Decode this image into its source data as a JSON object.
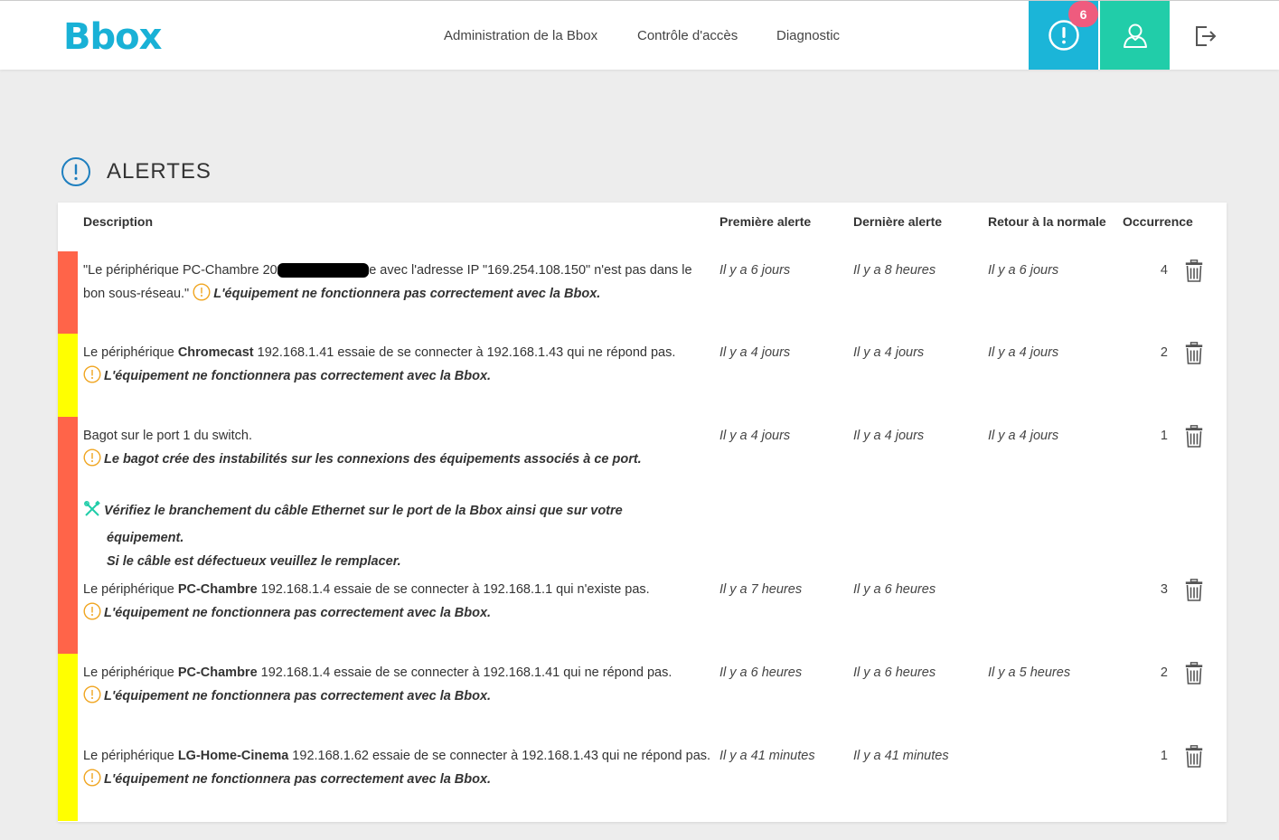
{
  "header": {
    "logo": "Bbox",
    "nav": [
      "Administration de la Bbox",
      "Contrôle d'accès",
      "Diagnostic"
    ],
    "alert_count": "6",
    "colors": {
      "brand": "#19b1d6",
      "alert_bg": "#1bb5d8",
      "user_bg": "#21cda9",
      "badge": "#ef5b7e"
    },
    "icons": {
      "alert": "exclamation-circle-icon",
      "user": "user-icon",
      "logout": "logout-icon"
    }
  },
  "page": {
    "title": "ALERTES"
  },
  "table": {
    "headers": {
      "description": "Description",
      "first": "Première alerte",
      "last": "Dernière alerte",
      "back": "Retour à la normale",
      "occ": "Occurrence"
    },
    "rows": [
      {
        "severity_color": "#ff6449",
        "desc_pre": "\"Le périphérique PC-Chambre 20",
        "desc_redacted": "xxxxxxxxxxxxxx",
        "desc_post": "e avec l'adresse IP \"169.254.108.150\" n'est pas dans le bon sous-réseau.\" ",
        "warning": "L'équipement ne fonctionnera pas correctement avec la Bbox.",
        "first": "Il y a 6 jours",
        "last": "Il y a 8 heures",
        "back": "Il y a 6 jours",
        "occurrence": "4"
      },
      {
        "severity_color": "#ffff00",
        "desc_pre": "Le périphérique ",
        "device": "Chromecast",
        "desc_post": " 192.168.1.41 essaie de se connecter à 192.168.1.43 qui ne répond pas.",
        "warning": "L'équipement ne fonctionnera pas correctement avec la Bbox.",
        "first": "Il y a 4 jours",
        "last": "Il y a 4 jours",
        "back": "Il y a 4 jours",
        "occurrence": "2"
      },
      {
        "severity_color": "#ff6449",
        "desc_pre": "Bagot sur le port 1 du switch.",
        "warning": "Le bagot crée des instabilités sur les connexions des équipements associés à ce port.",
        "fix_line1": "Vérifiez le branchement du câble Ethernet sur le port de la Bbox ainsi que sur votre",
        "fix_line2": "équipement.",
        "fix_line3": "Si le câble est défectueux veuillez le remplacer.",
        "first": "Il y a 4 jours",
        "last": "Il y a 4 jours",
        "back": "Il y a 4 jours",
        "occurrence": "1"
      },
      {
        "severity_color": "#ff6449",
        "desc_pre": "Le périphérique ",
        "device": "PC-Chambre",
        "desc_post": " 192.168.1.4 essaie de se connecter à 192.168.1.1 qui n'existe pas.",
        "warning": "L'équipement ne fonctionnera pas correctement avec la Bbox.",
        "first": "Il y a 7 heures",
        "last": "Il y a 6 heures",
        "back": "",
        "occurrence": "3"
      },
      {
        "severity_color": "#ffff00",
        "desc_pre": "Le périphérique ",
        "device": "PC-Chambre",
        "desc_post": " 192.168.1.4 essaie de se connecter à 192.168.1.41 qui ne répond pas.",
        "warning": "L'équipement ne fonctionnera pas correctement avec la Bbox.",
        "first": "Il y a 6 heures",
        "last": "Il y a 6 heures",
        "back": "Il y a 5 heures",
        "occurrence": "2"
      },
      {
        "severity_color": "#ffff00",
        "desc_pre": "Le périphérique ",
        "device": "LG-Home-Cinema",
        "desc_post": " 192.168.1.62 essaie de se connecter à 192.168.1.43 qui ne répond pas. ",
        "warning": "L'équipement ne fonctionnera pas correctement avec la Bbox.",
        "first": "Il y a 41 minutes",
        "last": "Il y a 41 minutes",
        "back": "",
        "occurrence": "1"
      }
    ]
  }
}
